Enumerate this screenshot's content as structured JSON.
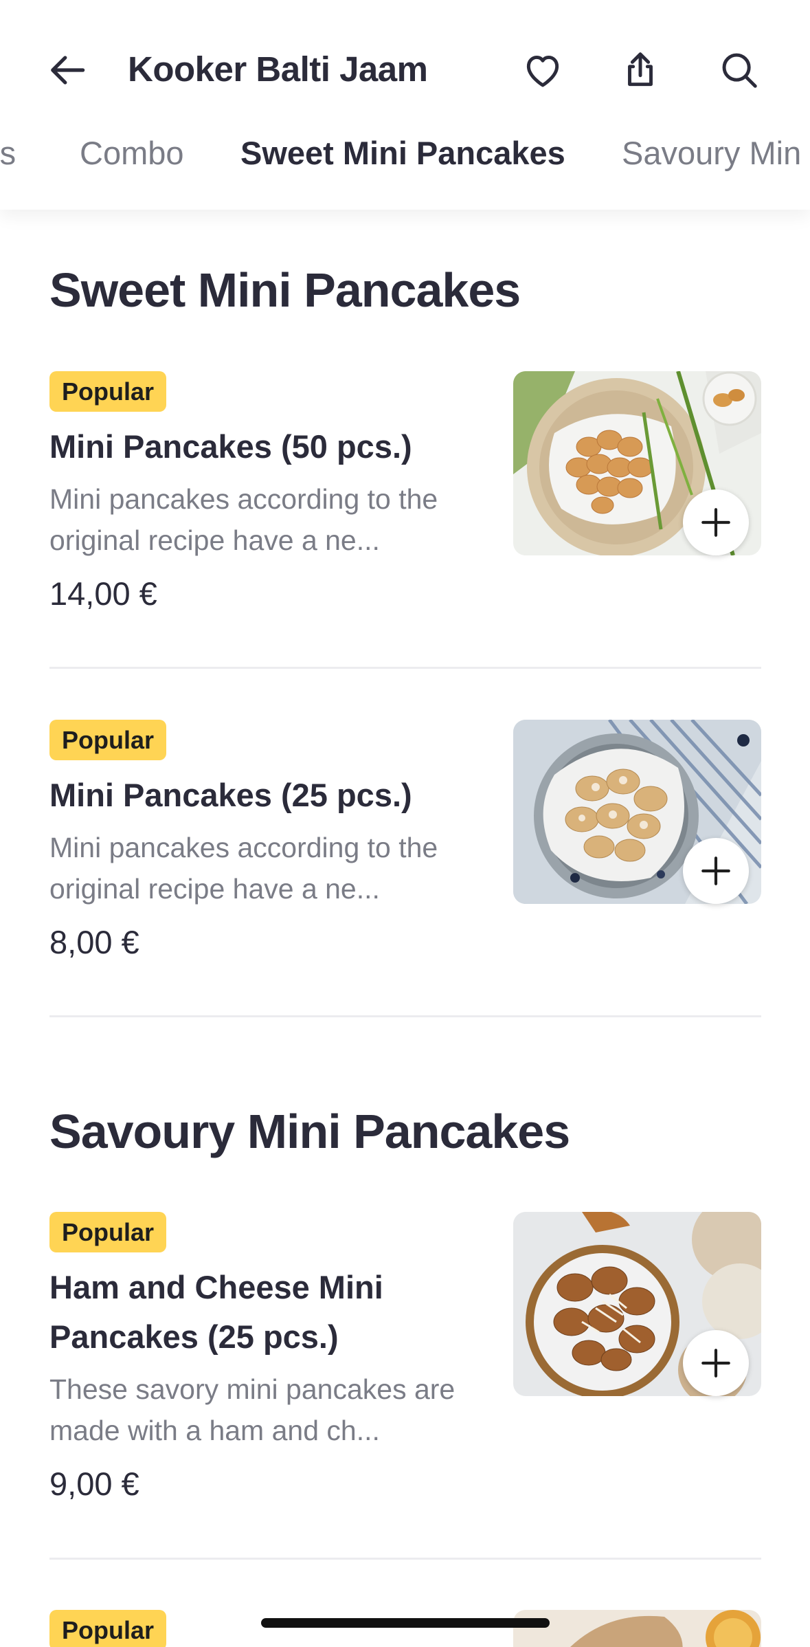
{
  "header": {
    "title": "Kooker Balti Jaam",
    "icons": [
      "back-arrow-icon",
      "heart-icon",
      "share-icon",
      "search-icon"
    ]
  },
  "tabs": [
    {
      "label": "rs",
      "active": false
    },
    {
      "label": "Combo",
      "active": false
    },
    {
      "label": "Sweet Mini Pancakes",
      "active": true
    },
    {
      "label": "Savoury Min",
      "active": false
    }
  ],
  "sections": [
    {
      "title": "Sweet Mini Pancakes",
      "items": [
        {
          "badge": "Popular",
          "name": "Mini Pancakes (50 pcs.)",
          "description": "Mini pancakes according to the original recipe have a ne...",
          "price": "14,00 €"
        },
        {
          "badge": "Popular",
          "name": "Mini Pancakes (25 pcs.)",
          "description": "Mini pancakes according to the original recipe have a ne...",
          "price": "8,00 €"
        }
      ]
    },
    {
      "title": "Savoury Mini Pancakes",
      "items": [
        {
          "badge": "Popular",
          "name": "Ham and Cheese Mini Pancakes (25 pcs.)",
          "description": "These savory mini pancakes are made with a ham and ch...",
          "price": "9,00 €"
        },
        {
          "badge": "Popular"
        }
      ]
    }
  ],
  "colors": {
    "badge": "#ffd454",
    "text_primary": "#2b2b3a",
    "text_secondary": "#7a7c86",
    "divider": "#ececef"
  }
}
